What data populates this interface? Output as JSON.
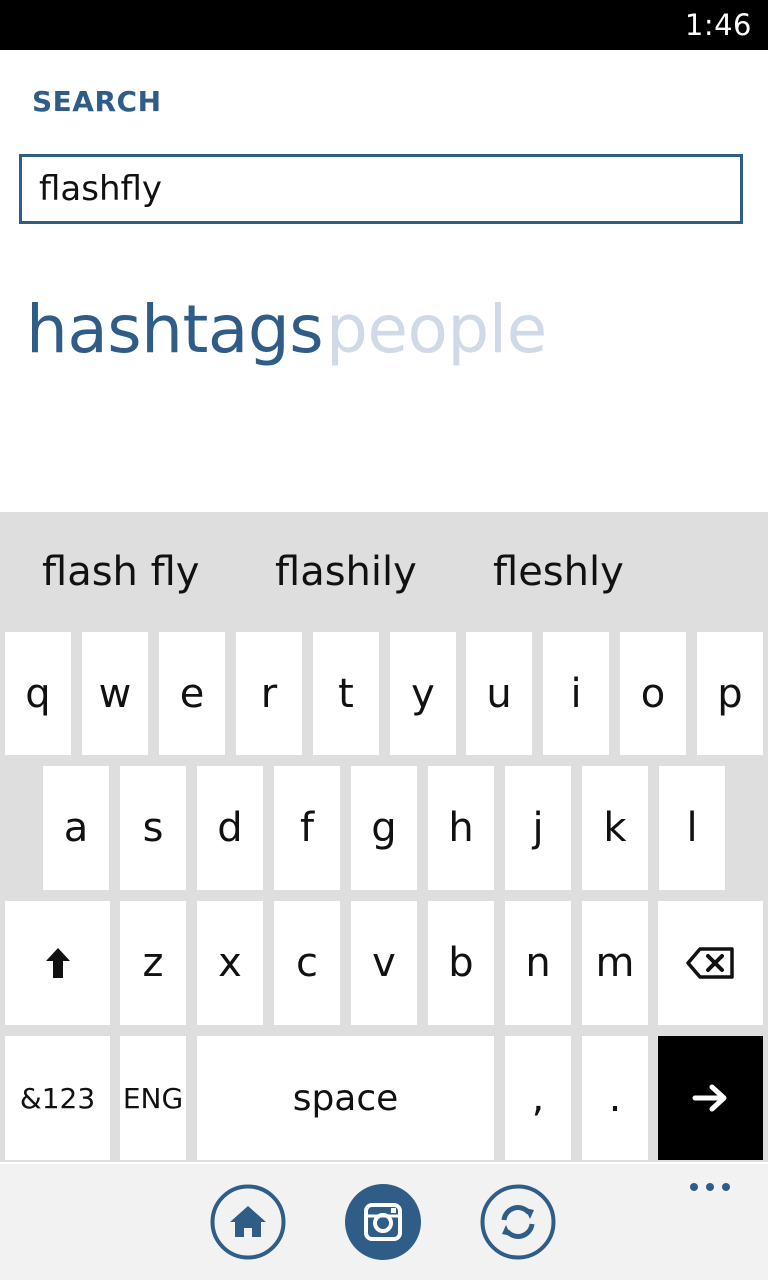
{
  "status_bar": {
    "time": "1:46"
  },
  "header": {
    "title": "SEARCH"
  },
  "search": {
    "value": "flashfly"
  },
  "pivots": [
    {
      "label": "hashtags",
      "state": "active"
    },
    {
      "label": "people",
      "state": "inactive"
    }
  ],
  "keyboard": {
    "suggestions": [
      "flash fly",
      "flashily",
      "fleshly"
    ],
    "rows": [
      [
        "q",
        "w",
        "e",
        "r",
        "t",
        "y",
        "u",
        "i",
        "o",
        "p"
      ],
      [
        "a",
        "s",
        "d",
        "f",
        "g",
        "h",
        "j",
        "k",
        "l"
      ],
      [
        "shift-icon",
        "z",
        "x",
        "c",
        "v",
        "b",
        "n",
        "m",
        "backspace-icon"
      ]
    ],
    "bottom_row": {
      "symbols": "&123",
      "language": "ENG",
      "space": "space",
      "comma": ",",
      "period": ".",
      "enter_icon": "arrow-right-icon"
    }
  },
  "app_bar": {
    "buttons": [
      "home-icon",
      "camera-icon",
      "refresh-icon"
    ],
    "more_icon": "ellipsis-icon"
  },
  "colors": {
    "accent": "#2f5d88",
    "pivot_inactive": "#cfdae6",
    "keyboard_bg": "#dedede",
    "status_bar_bg": "#000000"
  }
}
